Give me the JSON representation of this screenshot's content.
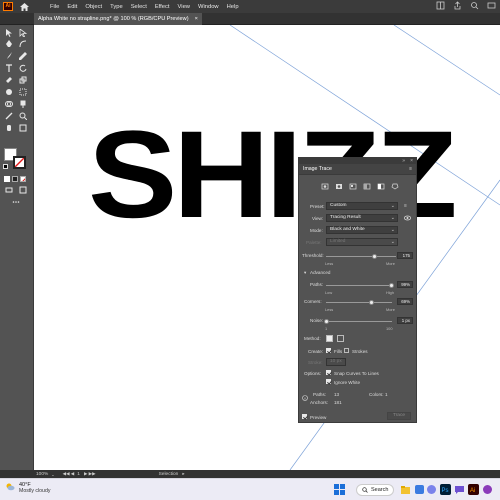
{
  "menu": {
    "app_logo": "Ai",
    "items": [
      "File",
      "Edit",
      "Object",
      "Type",
      "Select",
      "Effect",
      "View",
      "Window",
      "Help"
    ]
  },
  "document": {
    "tab_title": "Alpha White no strapline.png* @ 100 % (RGB/CPU Preview)",
    "close_glyph": "×"
  },
  "artwork": {
    "text": "SHIZZ"
  },
  "panel": {
    "title": "Image Trace",
    "preset_label": "Preset:",
    "preset_value": "Custom",
    "view_label": "View:",
    "view_value": "Tracing Result",
    "mode_label": "Mode:",
    "mode_value": "Black and White",
    "palette_label": "Palette:",
    "palette_value": "Limited",
    "threshold_label": "Threshold:",
    "threshold_value": "175",
    "threshold_fraction": 0.686,
    "threshold_min_label": "Less",
    "threshold_max_label": "More",
    "advanced_label": "Advanced",
    "paths_label": "Paths:",
    "paths_value": "99%",
    "paths_fraction": 0.99,
    "paths_min_label": "Low",
    "paths_max_label": "High",
    "corners_label": "Corners:",
    "corners_value": "69%",
    "corners_fraction": 0.69,
    "corners_min_label": "Less",
    "corners_max_label": "More",
    "noise_label": "Noise:",
    "noise_value": "1 px",
    "noise_fraction": 0.0,
    "noise_min_label": "1",
    "noise_max_label": "100",
    "method_label": "Method:",
    "create_label": "Create:",
    "fills_label": "Fills",
    "strokes_label": "Strokes",
    "stroke_label": "Stroke:",
    "stroke_value": "10 px",
    "options_label": "Options:",
    "snap_label": "Snap Curves To Lines",
    "ignore_white_label": "Ignore White",
    "paths_stat_label": "Paths:",
    "paths_stat_value": "13",
    "colors_stat_label": "Colors:",
    "colors_stat_value": "1",
    "anchors_stat_label": "Anchors:",
    "anchors_stat_value": "181",
    "preview_label": "Preview",
    "trace_button": "Trace"
  },
  "statusbar": {
    "zoom": "100%",
    "artboard": "1",
    "tool": "Selection"
  },
  "taskbar": {
    "temperature": "40°F",
    "condition": "Mostly cloudy",
    "search_label": "Search"
  }
}
